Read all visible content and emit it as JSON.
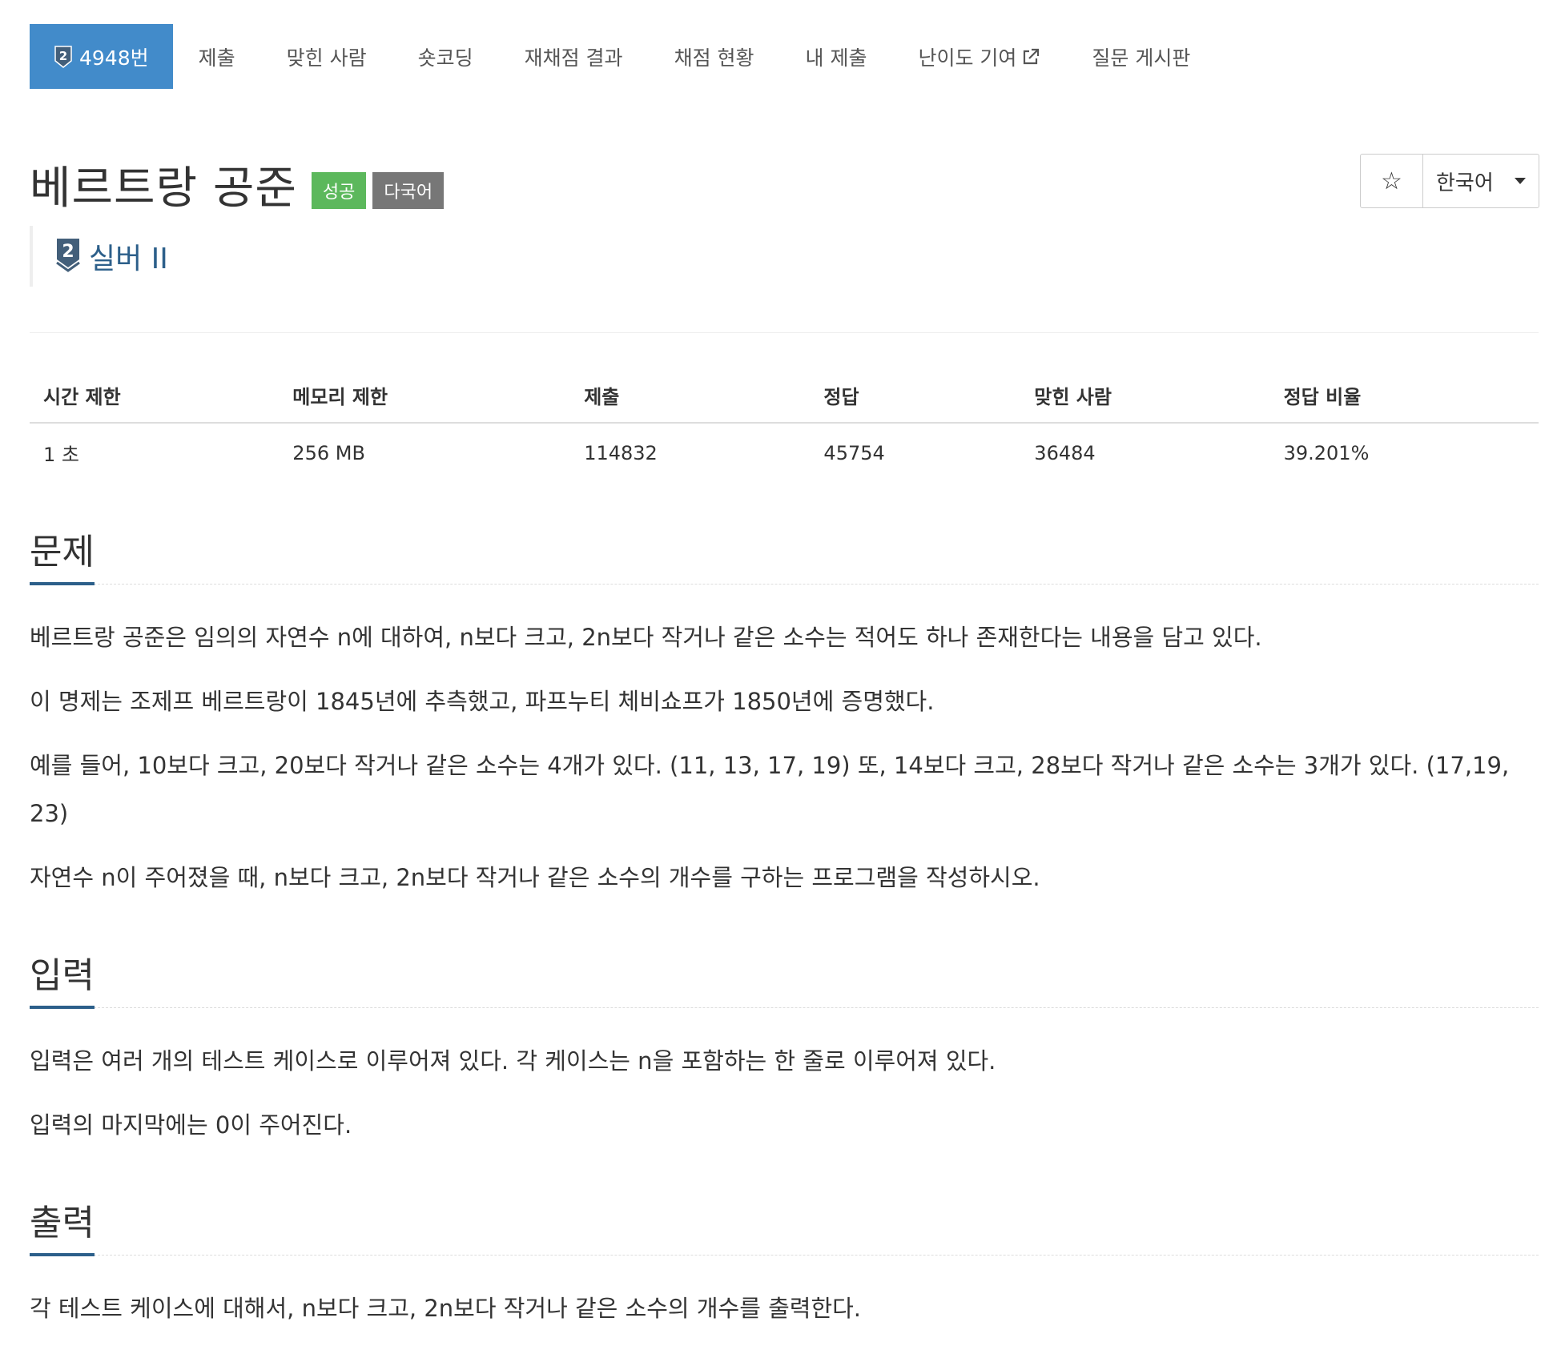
{
  "nav": {
    "problem_tier": "2",
    "items": [
      {
        "label": "4948번"
      },
      {
        "label": "제출"
      },
      {
        "label": "맞힌 사람"
      },
      {
        "label": "숏코딩"
      },
      {
        "label": "재채점 결과"
      },
      {
        "label": "채점 현황"
      },
      {
        "label": "내 제출"
      },
      {
        "label": "난이도 기여"
      },
      {
        "label": "질문 게시판"
      }
    ]
  },
  "problem": {
    "title": "베르트랑 공준",
    "labels": [
      "성공",
      "다국어"
    ],
    "tier_number": "2",
    "tier_name": "실버 II"
  },
  "language": {
    "star": "☆",
    "selected": "한국어"
  },
  "info": {
    "headers": [
      "시간 제한",
      "메모리 제한",
      "제출",
      "정답",
      "맞힌 사람",
      "정답 비율"
    ],
    "values": [
      "1 초",
      "256 MB",
      "114832",
      "45754",
      "36484",
      "39.201%"
    ]
  },
  "sections": {
    "problem": {
      "title": "문제",
      "paragraphs": [
        "베르트랑 공준은 임의의 자연수 n에 대하여, n보다 크고, 2n보다 작거나 같은 소수는 적어도 하나 존재한다는 내용을 담고 있다.",
        "이 명제는 조제프 베르트랑이 1845년에 추측했고, 파프누티 체비쇼프가 1850년에 증명했다.",
        "예를 들어, 10보다 크고, 20보다 작거나 같은 소수는 4개가 있다. (11, 13, 17, 19) 또, 14보다 크고, 28보다 작거나 같은 소수는 3개가 있다. (17,19, 23)",
        "자연수 n이 주어졌을 때, n보다 크고, 2n보다 작거나 같은 소수의 개수를 구하는 프로그램을 작성하시오."
      ]
    },
    "input": {
      "title": "입력",
      "paragraphs": [
        "입력은 여러 개의 테스트 케이스로 이루어져 있다. 각 케이스는 n을 포함하는 한 줄로 이루어져 있다.",
        "입력의 마지막에는 0이 주어진다."
      ]
    },
    "output": {
      "title": "출력",
      "paragraphs": [
        "각 테스트 케이스에 대해서, n보다 크고, 2n보다 작거나 같은 소수의 개수를 출력한다."
      ]
    }
  },
  "colors": {
    "accent": "#428bca",
    "tier_silver": "#435f7a",
    "label_success": "#5cb85c",
    "label_default": "#777777"
  }
}
